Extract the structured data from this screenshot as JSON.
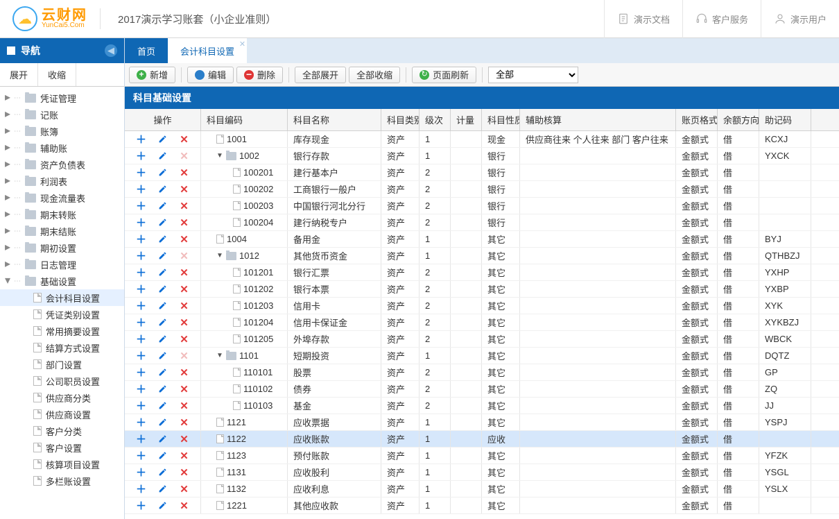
{
  "header": {
    "logo_cn": "云财网",
    "logo_en": "YunCai5.Com",
    "title": "2017演示学习账套（小企业准则）",
    "btn_doc": "演示文档",
    "btn_service": "客户服务",
    "btn_user": "演示用户"
  },
  "sidebar": {
    "title": "导航",
    "expand": "展开",
    "collapse": "收缩",
    "folders": [
      "凭证管理",
      "记账",
      "账簿",
      "辅助账",
      "资产负债表",
      "利润表",
      "现金流量表",
      "期末转账",
      "期末结账",
      "期初设置",
      "日志管理",
      "基础设置"
    ],
    "sub": [
      "会计科目设置",
      "凭证类别设置",
      "常用摘要设置",
      "结算方式设置",
      "部门设置",
      "公司职员设置",
      "供应商分类",
      "供应商设置",
      "客户分类",
      "客户设置",
      "核算项目设置",
      "多栏账设置"
    ]
  },
  "tabs": {
    "home": "首页",
    "active": "会计科目设置"
  },
  "toolbar": {
    "add": "新增",
    "edit": "编辑",
    "del": "删除",
    "expand_all": "全部展开",
    "collapse_all": "全部收缩",
    "refresh": "页面刷新",
    "filter": "全部"
  },
  "section": "科目基础设置",
  "cols": {
    "ops": "操作",
    "code": "科目编码",
    "name": "科目名称",
    "type": "科目类别",
    "lvl": "级次",
    "qty": "计量",
    "nat": "科目性质",
    "aux": "辅助核算",
    "fmt": "账页格式",
    "dir": "余额方向",
    "mn": "助记码"
  },
  "rows": [
    {
      "kind": "leaf",
      "ind": 1,
      "code": "1001",
      "name": "库存现金",
      "type": "资产",
      "lvl": "1",
      "nat": "现金",
      "aux": "供应商往来 个人往来 部门 客户往来",
      "fmt": "金额式",
      "dir": "借",
      "mn": "KCXJ",
      "xdim": false
    },
    {
      "kind": "fold",
      "ind": 1,
      "code": "1002",
      "name": "银行存款",
      "type": "资产",
      "lvl": "1",
      "nat": "银行",
      "aux": "",
      "fmt": "金额式",
      "dir": "借",
      "mn": "YXCK",
      "xdim": true
    },
    {
      "kind": "leaf",
      "ind": 2,
      "code": "100201",
      "name": "建行基本户",
      "type": "资产",
      "lvl": "2",
      "nat": "银行",
      "aux": "",
      "fmt": "金额式",
      "dir": "借",
      "mn": "",
      "xdim": false
    },
    {
      "kind": "leaf",
      "ind": 2,
      "code": "100202",
      "name": "工商银行一般户",
      "type": "资产",
      "lvl": "2",
      "nat": "银行",
      "aux": "",
      "fmt": "金额式",
      "dir": "借",
      "mn": "",
      "xdim": false
    },
    {
      "kind": "leaf",
      "ind": 2,
      "code": "100203",
      "name": "中国银行河北分行",
      "type": "资产",
      "lvl": "2",
      "nat": "银行",
      "aux": "",
      "fmt": "金额式",
      "dir": "借",
      "mn": "",
      "xdim": false
    },
    {
      "kind": "leaf",
      "ind": 2,
      "code": "100204",
      "name": "建行纳税专户",
      "type": "资产",
      "lvl": "2",
      "nat": "银行",
      "aux": "",
      "fmt": "金额式",
      "dir": "借",
      "mn": "",
      "xdim": false
    },
    {
      "kind": "leaf",
      "ind": 1,
      "code": "1004",
      "name": "备用金",
      "type": "资产",
      "lvl": "1",
      "nat": "其它",
      "aux": "",
      "fmt": "金额式",
      "dir": "借",
      "mn": "BYJ",
      "xdim": false
    },
    {
      "kind": "fold",
      "ind": 1,
      "code": "1012",
      "name": "其他货币资金",
      "type": "资产",
      "lvl": "1",
      "nat": "其它",
      "aux": "",
      "fmt": "金额式",
      "dir": "借",
      "mn": "QTHBZJ",
      "xdim": true
    },
    {
      "kind": "leaf",
      "ind": 2,
      "code": "101201",
      "name": "银行汇票",
      "type": "资产",
      "lvl": "2",
      "nat": "其它",
      "aux": "",
      "fmt": "金额式",
      "dir": "借",
      "mn": "YXHP",
      "xdim": false
    },
    {
      "kind": "leaf",
      "ind": 2,
      "code": "101202",
      "name": "银行本票",
      "type": "资产",
      "lvl": "2",
      "nat": "其它",
      "aux": "",
      "fmt": "金额式",
      "dir": "借",
      "mn": "YXBP",
      "xdim": false
    },
    {
      "kind": "leaf",
      "ind": 2,
      "code": "101203",
      "name": "信用卡",
      "type": "资产",
      "lvl": "2",
      "nat": "其它",
      "aux": "",
      "fmt": "金额式",
      "dir": "借",
      "mn": "XYK",
      "xdim": false
    },
    {
      "kind": "leaf",
      "ind": 2,
      "code": "101204",
      "name": "信用卡保证金",
      "type": "资产",
      "lvl": "2",
      "nat": "其它",
      "aux": "",
      "fmt": "金额式",
      "dir": "借",
      "mn": "XYKBZJ",
      "xdim": false
    },
    {
      "kind": "leaf",
      "ind": 2,
      "code": "101205",
      "name": "外埠存款",
      "type": "资产",
      "lvl": "2",
      "nat": "其它",
      "aux": "",
      "fmt": "金额式",
      "dir": "借",
      "mn": "WBCK",
      "xdim": false
    },
    {
      "kind": "fold",
      "ind": 1,
      "code": "1101",
      "name": "短期投资",
      "type": "资产",
      "lvl": "1",
      "nat": "其它",
      "aux": "",
      "fmt": "金额式",
      "dir": "借",
      "mn": "DQTZ",
      "xdim": true
    },
    {
      "kind": "leaf",
      "ind": 2,
      "code": "110101",
      "name": "股票",
      "type": "资产",
      "lvl": "2",
      "nat": "其它",
      "aux": "",
      "fmt": "金额式",
      "dir": "借",
      "mn": "GP",
      "xdim": false
    },
    {
      "kind": "leaf",
      "ind": 2,
      "code": "110102",
      "name": "债券",
      "type": "资产",
      "lvl": "2",
      "nat": "其它",
      "aux": "",
      "fmt": "金额式",
      "dir": "借",
      "mn": "ZQ",
      "xdim": false
    },
    {
      "kind": "leaf",
      "ind": 2,
      "code": "110103",
      "name": "基金",
      "type": "资产",
      "lvl": "2",
      "nat": "其它",
      "aux": "",
      "fmt": "金额式",
      "dir": "借",
      "mn": "JJ",
      "xdim": false
    },
    {
      "kind": "leaf",
      "ind": 1,
      "code": "1121",
      "name": "应收票据",
      "type": "资产",
      "lvl": "1",
      "nat": "其它",
      "aux": "",
      "fmt": "金额式",
      "dir": "借",
      "mn": "YSPJ",
      "xdim": false
    },
    {
      "kind": "leaf",
      "ind": 1,
      "code": "1122",
      "name": "应收账款",
      "type": "资产",
      "lvl": "1",
      "nat": "应收",
      "aux": "",
      "fmt": "金额式",
      "dir": "借",
      "mn": "",
      "xdim": false,
      "hover": true
    },
    {
      "kind": "leaf",
      "ind": 1,
      "code": "1123",
      "name": "预付账款",
      "type": "资产",
      "lvl": "1",
      "nat": "其它",
      "aux": "",
      "fmt": "金额式",
      "dir": "借",
      "mn": "YFZK",
      "xdim": false
    },
    {
      "kind": "leaf",
      "ind": 1,
      "code": "1131",
      "name": "应收股利",
      "type": "资产",
      "lvl": "1",
      "nat": "其它",
      "aux": "",
      "fmt": "金额式",
      "dir": "借",
      "mn": "YSGL",
      "xdim": false
    },
    {
      "kind": "leaf",
      "ind": 1,
      "code": "1132",
      "name": "应收利息",
      "type": "资产",
      "lvl": "1",
      "nat": "其它",
      "aux": "",
      "fmt": "金额式",
      "dir": "借",
      "mn": "YSLX",
      "xdim": false
    },
    {
      "kind": "leaf",
      "ind": 1,
      "code": "1221",
      "name": "其他应收款",
      "type": "资产",
      "lvl": "1",
      "nat": "其它",
      "aux": "",
      "fmt": "金额式",
      "dir": "借",
      "mn": "",
      "xdim": false
    }
  ]
}
